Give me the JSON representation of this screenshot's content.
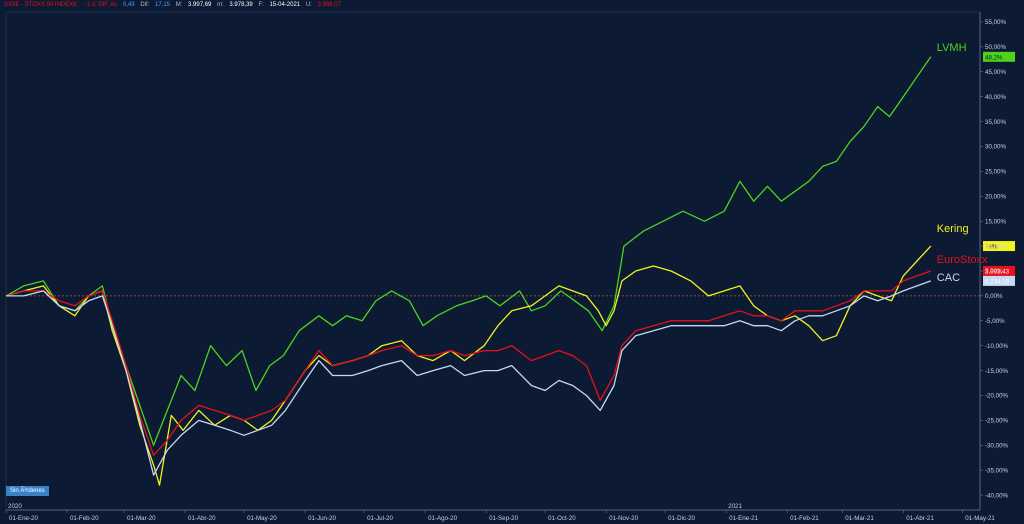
{
  "header": {
    "symbol": "SX5E - STOXX 50 INDEXK",
    "timeframe": "- 1 d, DIF, Ac",
    "change": "0,43",
    "dif_label": "Dif:",
    "dif_value": "17,15",
    "max_label": "M:",
    "max_value": "3.997,69",
    "min_label": "m:",
    "min_value": "3.978,39",
    "date_label": "F:",
    "date_value": "15-04-2021",
    "last_label": "U:",
    "last_value": "3.988,07"
  },
  "badge_label": "Sin Ã³rdenes",
  "colors": {
    "background": "#0c1a33",
    "lvmh": "#4fd21c",
    "kering": "#f2f21e",
    "eurostoxx": "#e8101a",
    "cac": "#c6d8f2",
    "zero_line": "#b0603a",
    "axis_text": "#c8d0dc"
  },
  "chart_data": {
    "type": "line",
    "ylim": [
      -43,
      57
    ],
    "yticks": [
      "55,00%",
      "50,00%",
      "45,00%",
      "40,00%",
      "35,00%",
      "30,00%",
      "25,00%",
      "20,00%",
      "15,00%",
      "10,00%",
      "5,00%",
      "0,00%",
      "-5,00%",
      "-10,00%",
      "-15,00%",
      "-20,00%",
      "-25,00%",
      "-30,00%",
      "-35,00%",
      "-40,00%"
    ],
    "ytick_values": [
      55,
      50,
      45,
      40,
      35,
      30,
      25,
      20,
      15,
      10,
      5,
      0,
      -5,
      -10,
      -15,
      -20,
      -25,
      -30,
      -35,
      -40
    ],
    "xticks": [
      "01-Ene-20",
      "01-Feb-20",
      "01-Mar-20",
      "01-Abr-20",
      "01-May-20",
      "01-Jun-20",
      "01-Jul-20",
      "01-Ago-20",
      "01-Sep-20",
      "01-Oct-20",
      "01-Nov-20",
      "01-Dic-20",
      "01-Ene-21",
      "01-Feb-21",
      "01-Mar-21",
      "01-Abr-21",
      "01-May-21"
    ],
    "xtick_dates": [
      "2020-01-01",
      "2020-02-01",
      "2020-03-01",
      "2020-04-01",
      "2020-05-01",
      "2020-06-01",
      "2020-07-01",
      "2020-08-01",
      "2020-09-01",
      "2020-10-01",
      "2020-11-01",
      "2020-12-01",
      "2021-01-01",
      "2021-02-01",
      "2021-03-01",
      "2021-04-01",
      "2021-05-01"
    ],
    "year_labels": [
      {
        "text": "2020",
        "date": "2020-01-01"
      },
      {
        "text": "2021",
        "date": "2021-01-01"
      }
    ],
    "zero_line": true,
    "series": [
      {
        "name": "LVMH",
        "color": "#4fd21c",
        "last_label": "48,2%",
        "points": [
          [
            "2020-01-01",
            0
          ],
          [
            "2020-01-10",
            2
          ],
          [
            "2020-01-20",
            3
          ],
          [
            "2020-01-28",
            -2
          ],
          [
            "2020-02-05",
            -3
          ],
          [
            "2020-02-12",
            0
          ],
          [
            "2020-02-19",
            2
          ],
          [
            "2020-02-24",
            -6
          ],
          [
            "2020-03-02",
            -14
          ],
          [
            "2020-03-09",
            -22
          ],
          [
            "2020-03-16",
            -30
          ],
          [
            "2020-03-23",
            -23
          ],
          [
            "2020-03-30",
            -16
          ],
          [
            "2020-04-06",
            -19
          ],
          [
            "2020-04-14",
            -10
          ],
          [
            "2020-04-22",
            -14
          ],
          [
            "2020-04-30",
            -11
          ],
          [
            "2020-05-07",
            -19
          ],
          [
            "2020-05-14",
            -14
          ],
          [
            "2020-05-21",
            -12
          ],
          [
            "2020-05-29",
            -7
          ],
          [
            "2020-06-08",
            -4
          ],
          [
            "2020-06-15",
            -6
          ],
          [
            "2020-06-22",
            -4
          ],
          [
            "2020-06-30",
            -5
          ],
          [
            "2020-07-07",
            -1
          ],
          [
            "2020-07-15",
            1
          ],
          [
            "2020-07-24",
            -1
          ],
          [
            "2020-07-31",
            -6
          ],
          [
            "2020-08-07",
            -4
          ],
          [
            "2020-08-17",
            -2
          ],
          [
            "2020-08-25",
            -1
          ],
          [
            "2020-09-01",
            0
          ],
          [
            "2020-09-08",
            -2
          ],
          [
            "2020-09-18",
            1
          ],
          [
            "2020-09-24",
            -3
          ],
          [
            "2020-10-01",
            -2
          ],
          [
            "2020-10-09",
            1
          ],
          [
            "2020-10-16",
            -1
          ],
          [
            "2020-10-23",
            -3
          ],
          [
            "2020-10-30",
            -7
          ],
          [
            "2020-11-05",
            -2
          ],
          [
            "2020-11-10",
            10
          ],
          [
            "2020-11-20",
            13
          ],
          [
            "2020-11-30",
            15
          ],
          [
            "2020-12-10",
            17
          ],
          [
            "2020-12-21",
            15
          ],
          [
            "2020-12-31",
            17
          ],
          [
            "2021-01-08",
            23
          ],
          [
            "2021-01-15",
            19
          ],
          [
            "2021-01-22",
            22
          ],
          [
            "2021-01-29",
            19
          ],
          [
            "2021-02-05",
            21
          ],
          [
            "2021-02-12",
            23
          ],
          [
            "2021-02-19",
            26
          ],
          [
            "2021-02-26",
            27
          ],
          [
            "2021-03-05",
            31
          ],
          [
            "2021-03-12",
            34
          ],
          [
            "2021-03-19",
            38
          ],
          [
            "2021-03-25",
            36
          ],
          [
            "2021-04-01",
            40
          ],
          [
            "2021-04-08",
            44
          ],
          [
            "2021-04-15",
            48
          ]
        ]
      },
      {
        "name": "Kering",
        "color": "#f2f21e",
        "last_label": "13%",
        "points": [
          [
            "2020-01-01",
            0
          ],
          [
            "2020-01-10",
            1
          ],
          [
            "2020-01-20",
            2
          ],
          [
            "2020-01-28",
            -2
          ],
          [
            "2020-02-05",
            -4
          ],
          [
            "2020-02-12",
            0
          ],
          [
            "2020-02-19",
            1
          ],
          [
            "2020-02-24",
            -7
          ],
          [
            "2020-03-02",
            -15
          ],
          [
            "2020-03-09",
            -26
          ],
          [
            "2020-03-16",
            -34
          ],
          [
            "2020-03-19",
            -38
          ],
          [
            "2020-03-25",
            -24
          ],
          [
            "2020-03-31",
            -27
          ],
          [
            "2020-04-08",
            -23
          ],
          [
            "2020-04-16",
            -26
          ],
          [
            "2020-04-24",
            -24
          ],
          [
            "2020-05-01",
            -25
          ],
          [
            "2020-05-08",
            -27
          ],
          [
            "2020-05-15",
            -25
          ],
          [
            "2020-05-22",
            -21
          ],
          [
            "2020-06-01",
            -15
          ],
          [
            "2020-06-08",
            -12
          ],
          [
            "2020-06-15",
            -14
          ],
          [
            "2020-06-25",
            -13
          ],
          [
            "2020-07-03",
            -12
          ],
          [
            "2020-07-10",
            -10
          ],
          [
            "2020-07-20",
            -9
          ],
          [
            "2020-07-28",
            -12
          ],
          [
            "2020-08-05",
            -13
          ],
          [
            "2020-08-14",
            -11
          ],
          [
            "2020-08-21",
            -13
          ],
          [
            "2020-08-31",
            -10
          ],
          [
            "2020-09-07",
            -6
          ],
          [
            "2020-09-14",
            -3
          ],
          [
            "2020-09-24",
            -2
          ],
          [
            "2020-10-01",
            0
          ],
          [
            "2020-10-08",
            2
          ],
          [
            "2020-10-15",
            1
          ],
          [
            "2020-10-22",
            0
          ],
          [
            "2020-10-28",
            -3
          ],
          [
            "2020-11-01",
            -6
          ],
          [
            "2020-11-05",
            -3
          ],
          [
            "2020-11-09",
            3
          ],
          [
            "2020-11-16",
            5
          ],
          [
            "2020-11-25",
            6
          ],
          [
            "2020-12-04",
            5
          ],
          [
            "2020-12-14",
            3
          ],
          [
            "2020-12-23",
            0
          ],
          [
            "2020-12-31",
            1
          ],
          [
            "2021-01-08",
            2
          ],
          [
            "2021-01-15",
            -2
          ],
          [
            "2021-01-22",
            -4
          ],
          [
            "2021-01-29",
            -5
          ],
          [
            "2021-02-05",
            -4
          ],
          [
            "2021-02-12",
            -6
          ],
          [
            "2021-02-19",
            -9
          ],
          [
            "2021-02-26",
            -8
          ],
          [
            "2021-03-05",
            -2
          ],
          [
            "2021-03-12",
            1
          ],
          [
            "2021-03-19",
            0
          ],
          [
            "2021-03-26",
            -1
          ],
          [
            "2021-04-01",
            4
          ],
          [
            "2021-04-08",
            7
          ],
          [
            "2021-04-15",
            10
          ]
        ]
      },
      {
        "name": "EuroStoxx",
        "color": "#e8101a",
        "last_label": "3.993,43",
        "points": [
          [
            "2020-01-01",
            0
          ],
          [
            "2020-01-10",
            1
          ],
          [
            "2020-01-20",
            1
          ],
          [
            "2020-01-28",
            -1
          ],
          [
            "2020-02-05",
            -2
          ],
          [
            "2020-02-12",
            0
          ],
          [
            "2020-02-19",
            1
          ],
          [
            "2020-02-24",
            -5
          ],
          [
            "2020-03-02",
            -14
          ],
          [
            "2020-03-09",
            -24
          ],
          [
            "2020-03-16",
            -32
          ],
          [
            "2020-03-23",
            -29
          ],
          [
            "2020-03-30",
            -25
          ],
          [
            "2020-04-08",
            -22
          ],
          [
            "2020-04-16",
            -23
          ],
          [
            "2020-04-24",
            -24
          ],
          [
            "2020-05-01",
            -25
          ],
          [
            "2020-05-08",
            -24
          ],
          [
            "2020-05-15",
            -23
          ],
          [
            "2020-05-22",
            -21
          ],
          [
            "2020-06-01",
            -15
          ],
          [
            "2020-06-08",
            -11
          ],
          [
            "2020-06-15",
            -14
          ],
          [
            "2020-06-25",
            -13
          ],
          [
            "2020-07-03",
            -12
          ],
          [
            "2020-07-10",
            -11
          ],
          [
            "2020-07-20",
            -10
          ],
          [
            "2020-07-28",
            -12
          ],
          [
            "2020-08-05",
            -12
          ],
          [
            "2020-08-14",
            -11
          ],
          [
            "2020-08-21",
            -12
          ],
          [
            "2020-08-31",
            -11
          ],
          [
            "2020-09-07",
            -11
          ],
          [
            "2020-09-14",
            -10
          ],
          [
            "2020-09-24",
            -13
          ],
          [
            "2020-10-01",
            -12
          ],
          [
            "2020-10-08",
            -11
          ],
          [
            "2020-10-15",
            -12
          ],
          [
            "2020-10-22",
            -14
          ],
          [
            "2020-10-29",
            -21
          ],
          [
            "2020-11-05",
            -16
          ],
          [
            "2020-11-09",
            -10
          ],
          [
            "2020-11-16",
            -7
          ],
          [
            "2020-11-25",
            -6
          ],
          [
            "2020-12-04",
            -5
          ],
          [
            "2020-12-14",
            -5
          ],
          [
            "2020-12-23",
            -5
          ],
          [
            "2020-12-31",
            -4
          ],
          [
            "2021-01-08",
            -3
          ],
          [
            "2021-01-15",
            -4
          ],
          [
            "2021-01-22",
            -4
          ],
          [
            "2021-01-29",
            -5
          ],
          [
            "2021-02-05",
            -3
          ],
          [
            "2021-02-12",
            -3
          ],
          [
            "2021-02-19",
            -3
          ],
          [
            "2021-02-26",
            -2
          ],
          [
            "2021-03-05",
            -1
          ],
          [
            "2021-03-12",
            1
          ],
          [
            "2021-03-19",
            1
          ],
          [
            "2021-03-26",
            1
          ],
          [
            "2021-04-01",
            3
          ],
          [
            "2021-04-08",
            4
          ],
          [
            "2021-04-15",
            5
          ]
        ]
      },
      {
        "name": "CAC",
        "color": "#c6d8f2",
        "last_label": "6.234,18",
        "points": [
          [
            "2020-01-01",
            0
          ],
          [
            "2020-01-10",
            0
          ],
          [
            "2020-01-20",
            1
          ],
          [
            "2020-01-28",
            -2
          ],
          [
            "2020-02-05",
            -3
          ],
          [
            "2020-02-12",
            -1
          ],
          [
            "2020-02-19",
            0
          ],
          [
            "2020-02-24",
            -6
          ],
          [
            "2020-03-02",
            -15
          ],
          [
            "2020-03-09",
            -25
          ],
          [
            "2020-03-16",
            -36
          ],
          [
            "2020-03-23",
            -31
          ],
          [
            "2020-03-30",
            -28
          ],
          [
            "2020-04-08",
            -25
          ],
          [
            "2020-04-16",
            -26
          ],
          [
            "2020-04-24",
            -27
          ],
          [
            "2020-05-01",
            -28
          ],
          [
            "2020-05-08",
            -27
          ],
          [
            "2020-05-15",
            -26
          ],
          [
            "2020-05-22",
            -23
          ],
          [
            "2020-06-01",
            -17
          ],
          [
            "2020-06-08",
            -13
          ],
          [
            "2020-06-15",
            -16
          ],
          [
            "2020-06-25",
            -16
          ],
          [
            "2020-07-03",
            -15
          ],
          [
            "2020-07-10",
            -14
          ],
          [
            "2020-07-20",
            -13
          ],
          [
            "2020-07-28",
            -16
          ],
          [
            "2020-08-05",
            -15
          ],
          [
            "2020-08-14",
            -14
          ],
          [
            "2020-08-21",
            -16
          ],
          [
            "2020-08-31",
            -15
          ],
          [
            "2020-09-07",
            -15
          ],
          [
            "2020-09-14",
            -14
          ],
          [
            "2020-09-24",
            -18
          ],
          [
            "2020-10-01",
            -19
          ],
          [
            "2020-10-08",
            -17
          ],
          [
            "2020-10-15",
            -18
          ],
          [
            "2020-10-22",
            -20
          ],
          [
            "2020-10-29",
            -23
          ],
          [
            "2020-11-05",
            -18
          ],
          [
            "2020-11-09",
            -11
          ],
          [
            "2020-11-16",
            -8
          ],
          [
            "2020-11-25",
            -7
          ],
          [
            "2020-12-04",
            -6
          ],
          [
            "2020-12-14",
            -6
          ],
          [
            "2020-12-23",
            -6
          ],
          [
            "2020-12-31",
            -6
          ],
          [
            "2021-01-08",
            -5
          ],
          [
            "2021-01-15",
            -6
          ],
          [
            "2021-01-22",
            -6
          ],
          [
            "2021-01-29",
            -7
          ],
          [
            "2021-02-05",
            -5
          ],
          [
            "2021-02-12",
            -4
          ],
          [
            "2021-02-19",
            -4
          ],
          [
            "2021-02-26",
            -3
          ],
          [
            "2021-03-05",
            -2
          ],
          [
            "2021-03-12",
            0
          ],
          [
            "2021-03-19",
            -1
          ],
          [
            "2021-03-26",
            0
          ],
          [
            "2021-04-01",
            1
          ],
          [
            "2021-04-08",
            2
          ],
          [
            "2021-04-15",
            3
          ]
        ]
      }
    ]
  }
}
